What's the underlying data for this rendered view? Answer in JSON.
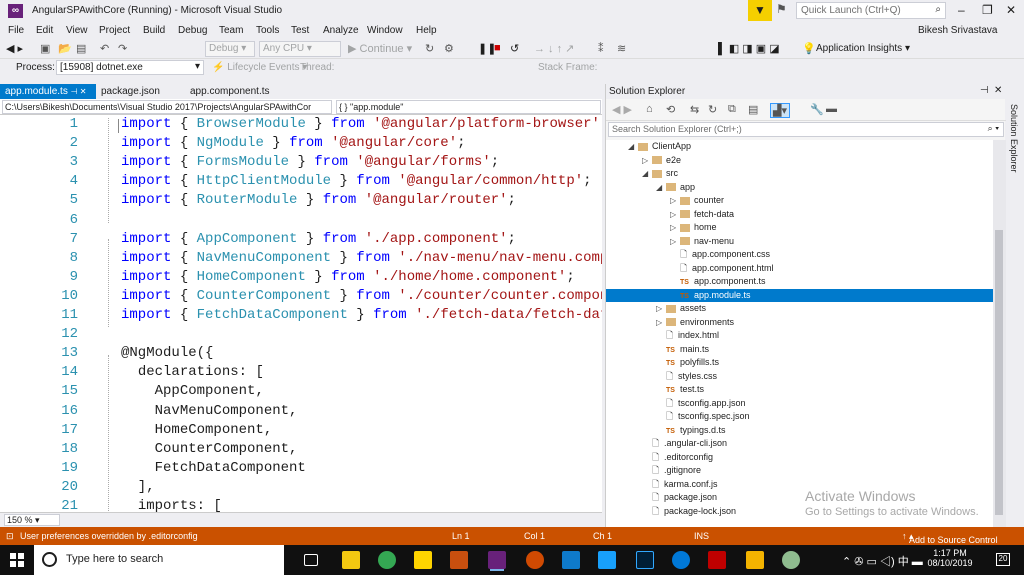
{
  "window": {
    "title": "AngularSPAwithCore (Running) - Microsoft Visual Studio",
    "quick_launch_placeholder": "Quick Launch (Ctrl+Q)",
    "user": "Bikesh Srivastava"
  },
  "menu": [
    "File",
    "Edit",
    "View",
    "Project",
    "Build",
    "Debug",
    "Team",
    "Tools",
    "Test",
    "Analyze",
    "Window",
    "Help"
  ],
  "toolbar": {
    "config": "Debug",
    "platform": "Any CPU",
    "continue": "Continue",
    "app_insights": "Application Insights"
  },
  "debug_bar": {
    "process_label": "Process:",
    "process_value": "[15908] dotnet.exe",
    "lifecycle": "Lifecycle Events",
    "thread": "Thread:",
    "stack_frame": "Stack Frame:"
  },
  "tabs": [
    {
      "label": "app.module.ts",
      "active": true
    },
    {
      "label": "package.json",
      "active": false
    },
    {
      "label": "app.component.ts",
      "active": false
    }
  ],
  "editor": {
    "path": "C:\\Users\\Bikesh\\Documents\\Visual Studio 2017\\Projects\\AngularSPAwithCor",
    "symbol": "{ } \"app.module\"",
    "zoom": "150 %",
    "lines": [
      {
        "n": "1",
        "code": "import { BrowserModule } from '@angular/platform-browser';"
      },
      {
        "n": "2",
        "code": "import { NgModule } from '@angular/core';"
      },
      {
        "n": "3",
        "code": "import { FormsModule } from '@angular/forms';"
      },
      {
        "n": "4",
        "code": "import { HttpClientModule } from '@angular/common/http';"
      },
      {
        "n": "5",
        "code": "import { RouterModule } from '@angular/router';"
      },
      {
        "n": "6",
        "code": ""
      },
      {
        "n": "7",
        "code": "import { AppComponent } from './app.component';"
      },
      {
        "n": "8",
        "code": "import { NavMenuComponent } from './nav-menu/nav-menu.compon"
      },
      {
        "n": "9",
        "code": "import { HomeComponent } from './home/home.component';"
      },
      {
        "n": "10",
        "code": "import { CounterComponent } from './counter/counter.componen"
      },
      {
        "n": "11",
        "code": "import { FetchDataComponent } from './fetch-data/fetch-data."
      },
      {
        "n": "12",
        "code": ""
      },
      {
        "n": "13",
        "code": "@NgModule({"
      },
      {
        "n": "14",
        "code": "  declarations: ["
      },
      {
        "n": "15",
        "code": "    AppComponent,"
      },
      {
        "n": "16",
        "code": "    NavMenuComponent,"
      },
      {
        "n": "17",
        "code": "    HomeComponent,"
      },
      {
        "n": "18",
        "code": "    CounterComponent,"
      },
      {
        "n": "19",
        "code": "    FetchDataComponent"
      },
      {
        "n": "20",
        "code": "  ],"
      },
      {
        "n": "21",
        "code": "  imports: ["
      }
    ]
  },
  "solution_explorer": {
    "title": "Solution Explorer",
    "search_placeholder": "Search Solution Explorer (Ctrl+;)",
    "side_tab": "Solution Explorer",
    "nodes": [
      {
        "label": "ClientApp",
        "depth": 0,
        "kind": "folder",
        "expander": "open",
        "selected": false
      },
      {
        "label": "e2e",
        "depth": 1,
        "kind": "folder",
        "expander": "closed",
        "selected": false
      },
      {
        "label": "src",
        "depth": 1,
        "kind": "folder",
        "expander": "open",
        "selected": false
      },
      {
        "label": "app",
        "depth": 2,
        "kind": "folder",
        "expander": "open",
        "selected": false
      },
      {
        "label": "counter",
        "depth": 3,
        "kind": "folder",
        "expander": "closed",
        "selected": false
      },
      {
        "label": "fetch-data",
        "depth": 3,
        "kind": "folder",
        "expander": "closed",
        "selected": false
      },
      {
        "label": "home",
        "depth": 3,
        "kind": "folder",
        "expander": "closed",
        "selected": false
      },
      {
        "label": "nav-menu",
        "depth": 3,
        "kind": "folder",
        "expander": "closed",
        "selected": false
      },
      {
        "label": "app.component.css",
        "depth": 3,
        "kind": "doc",
        "expander": "none",
        "selected": false
      },
      {
        "label": "app.component.html",
        "depth": 3,
        "kind": "doc",
        "expander": "none",
        "selected": false
      },
      {
        "label": "app.component.ts",
        "depth": 3,
        "kind": "ts",
        "expander": "none",
        "selected": false
      },
      {
        "label": "app.module.ts",
        "depth": 3,
        "kind": "ts",
        "expander": "none",
        "selected": true
      },
      {
        "label": "assets",
        "depth": 2,
        "kind": "folder",
        "expander": "closed",
        "selected": false
      },
      {
        "label": "environments",
        "depth": 2,
        "kind": "folder",
        "expander": "closed",
        "selected": false
      },
      {
        "label": "index.html",
        "depth": 2,
        "kind": "doc",
        "expander": "none",
        "selected": false
      },
      {
        "label": "main.ts",
        "depth": 2,
        "kind": "ts",
        "expander": "none",
        "selected": false
      },
      {
        "label": "polyfills.ts",
        "depth": 2,
        "kind": "ts",
        "expander": "none",
        "selected": false
      },
      {
        "label": "styles.css",
        "depth": 2,
        "kind": "doc",
        "expander": "none",
        "selected": false
      },
      {
        "label": "test.ts",
        "depth": 2,
        "kind": "ts",
        "expander": "none",
        "selected": false
      },
      {
        "label": "tsconfig.app.json",
        "depth": 2,
        "kind": "doc",
        "expander": "none",
        "selected": false
      },
      {
        "label": "tsconfig.spec.json",
        "depth": 2,
        "kind": "doc",
        "expander": "none",
        "selected": false
      },
      {
        "label": "typings.d.ts",
        "depth": 2,
        "kind": "ts",
        "expander": "none",
        "selected": false
      },
      {
        "label": ".angular-cli.json",
        "depth": 1,
        "kind": "doc",
        "expander": "none",
        "selected": false
      },
      {
        "label": ".editorconfig",
        "depth": 1,
        "kind": "doc",
        "expander": "none",
        "selected": false
      },
      {
        "label": ".gitignore",
        "depth": 1,
        "kind": "doc",
        "expander": "none",
        "selected": false
      },
      {
        "label": "karma.conf.js",
        "depth": 1,
        "kind": "doc",
        "expander": "none",
        "selected": false
      },
      {
        "label": "package.json",
        "depth": 1,
        "kind": "doc",
        "expander": "none",
        "selected": false
      },
      {
        "label": "package-lock.json",
        "depth": 1,
        "kind": "doc",
        "expander": "none",
        "selected": false
      }
    ],
    "watermark_line1": "Activate Windows",
    "watermark_line2": "Go to Settings to activate Windows."
  },
  "status": {
    "message": "User preferences overridden by .editorconfig",
    "ln": "Ln 1",
    "col": "Col 1",
    "ch": "Ch 1",
    "ins": "INS",
    "source_control": "Add to Source Control"
  },
  "taskbar": {
    "search_placeholder": "Type here to search",
    "time": "1:17 PM",
    "date": "08/10/2019",
    "notifications": "20"
  },
  "colors": {
    "accent": "#007acc",
    "status_bar": "#ca5100",
    "keyword": "#0000ff",
    "string": "#a31515",
    "type": "#2b91af"
  }
}
